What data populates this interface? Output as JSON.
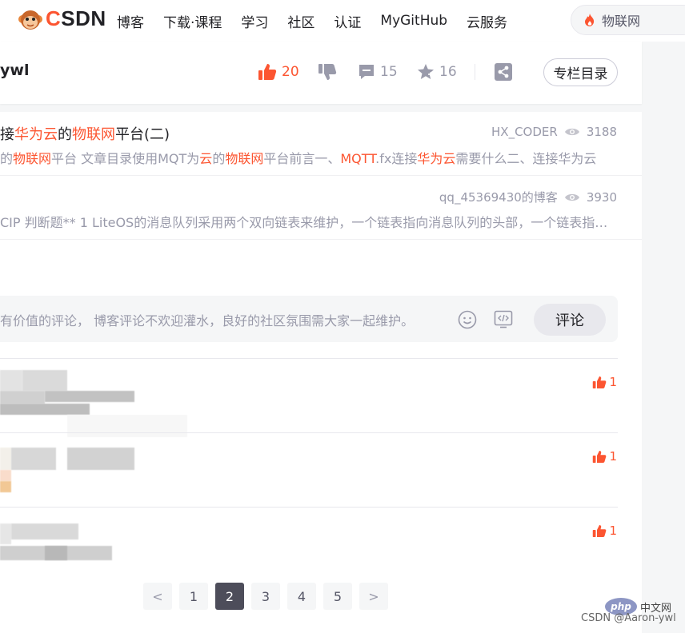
{
  "nav": {
    "logo_text_c": "C",
    "logo_text_rest": "SDN",
    "items": [
      "博客",
      "下载·课程",
      "学习",
      "社区",
      "认证",
      "MyGitHub",
      "云服务"
    ],
    "search_text": "物联网"
  },
  "toolbar": {
    "author": "ywl",
    "likes": "20",
    "comments": "15",
    "favorites": "16",
    "catalog_label": "专栏目录"
  },
  "recommend": [
    {
      "title_parts": [
        "接",
        "华为云",
        "的",
        "物联网",
        "平台(二)"
      ],
      "author": "HX_CODER",
      "views": "3188",
      "desc_parts": [
        "的",
        "物联网",
        "平台 文章目录使用MQT为",
        "云",
        "的",
        "物联网",
        "平台前言一、",
        "MQTT",
        ".fx连接",
        "华为云",
        "需要什么二、连接华为云"
      ]
    },
    {
      "author": "qq_45369430的博客",
      "views": "3930",
      "desc": "CIP 判断题** 1 LiteOS的消息队列采用两个双向链表来维护，一个链表指向消息队列的头部，一个链表指向消息队列的尾部"
    }
  ],
  "comment_box": {
    "placeholder": "有价值的评论， 博客评论不欢迎灌水，良好的社区氛围需大家一起维护。",
    "submit_label": "评论"
  },
  "comments": [
    {
      "likes": "1"
    },
    {
      "likes": "1"
    },
    {
      "likes": "1"
    }
  ],
  "pagination": {
    "prev": "<",
    "pages": [
      "1",
      "2",
      "3",
      "4",
      "5"
    ],
    "active": "2",
    "next": ">"
  },
  "watermark": {
    "php_logo": "php",
    "cn_text": "中文网",
    "csdn_text": "CSDN @Aaron-ywl"
  },
  "colors": {
    "brand_red": "#fc5531",
    "text_primary": "#222226",
    "text_muted": "#999aaa",
    "pager_active": "#4d4d5a"
  }
}
